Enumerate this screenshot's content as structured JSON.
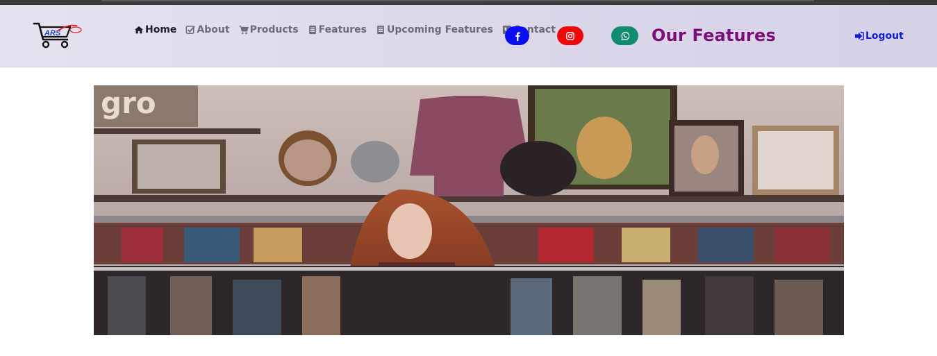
{
  "nav": {
    "logo_text": "ARS",
    "links": [
      {
        "label": "Home",
        "icon": "home-icon",
        "active": true
      },
      {
        "label": "About",
        "icon": "check-icon",
        "active": false
      },
      {
        "label": "Products",
        "icon": "cart-icon",
        "active": false
      },
      {
        "label": "Features",
        "icon": "document-icon",
        "active": false
      },
      {
        "label": "Upcoming Features",
        "icon": "document-icon",
        "active": false
      },
      {
        "label": "Contact",
        "icon": "phone-icon",
        "active": false
      }
    ],
    "social": [
      {
        "name": "facebook",
        "icon": "facebook-icon",
        "color": "#0a0ff2"
      },
      {
        "name": "instagram",
        "icon": "instagram-icon",
        "color": "#f00707"
      },
      {
        "name": "whatsapp",
        "icon": "whatsapp-icon",
        "color": "#128c6e"
      }
    ],
    "page_title": "Our Features",
    "logout_label": "Logout"
  },
  "hero": {
    "image": "woman-behind-clothing-rack-in-thrift-store",
    "sign_text": "gro"
  },
  "colors": {
    "title": "#7a0f7a",
    "logout": "#0f1ed1",
    "nav_text": "#6f6a78",
    "nav_active": "#1e1b24"
  }
}
